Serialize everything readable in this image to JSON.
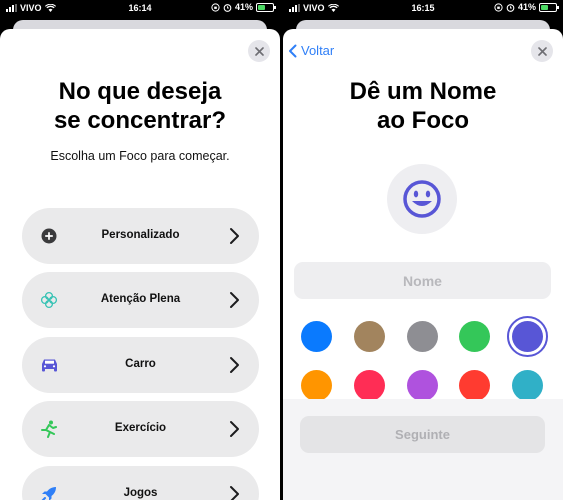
{
  "left_screen": {
    "status": {
      "carrier": "VIVO",
      "time": "16:14",
      "battery": "41%"
    },
    "title_line1": "No que deseja",
    "title_line2": "se concentrar?",
    "subtitle": "Escolha um Foco para começar.",
    "items": [
      {
        "label": "Personalizado",
        "icon": "plus-circle-icon",
        "color": "#3a3a3c"
      },
      {
        "label": "Atenção Plena",
        "icon": "flower-icon",
        "color": "#36c2b4"
      },
      {
        "label": "Carro",
        "icon": "car-icon",
        "color": "#5856d6"
      },
      {
        "label": "Exercício",
        "icon": "running-icon",
        "color": "#34c759"
      },
      {
        "label": "Jogos",
        "icon": "rocket-icon",
        "color": "#2f7ff7"
      }
    ]
  },
  "right_screen": {
    "status": {
      "carrier": "VIVO",
      "time": "16:15",
      "battery": "41%"
    },
    "back_label": "Voltar",
    "title_line1": "Dê um Nome",
    "title_line2": "ao Foco",
    "emoji_icon": "smiley-icon",
    "name_placeholder": "Nome",
    "colors": [
      "#0a7afe",
      "#a2845e",
      "#8e8e93",
      "#34c759",
      "#5856d6",
      "#ff9500",
      "#ff2d55",
      "#af52de",
      "#ff3b30",
      "#30b0c7"
    ],
    "selected_color": "#5856d6",
    "next_label": "Seguinte"
  }
}
